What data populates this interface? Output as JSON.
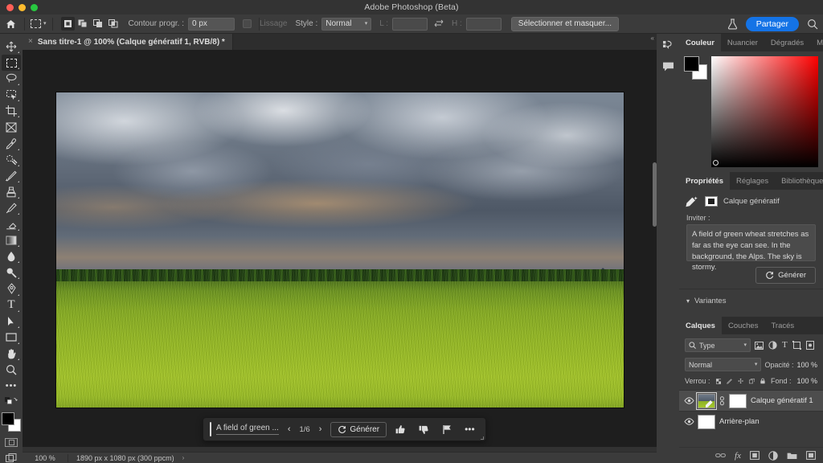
{
  "window": {
    "title": "Adobe Photoshop (Beta)",
    "traffic_lights": [
      "close",
      "minimize",
      "zoom"
    ],
    "accent_color": "#1473e6",
    "chrome_color": "#3b3b3b"
  },
  "options_bar": {
    "home_icon": "home-icon",
    "active_tool": "rectangular-marquee",
    "tool_preset_caret": "⌄",
    "boolean_modes": [
      {
        "name": "new-selection",
        "active": true
      },
      {
        "name": "add-to-selection",
        "active": false
      },
      {
        "name": "subtract-from-selection",
        "active": false
      },
      {
        "name": "intersect-selection",
        "active": false
      }
    ],
    "feather_label": "Contour progr. :",
    "feather_value": "0 px",
    "antialias_label": "Lissage",
    "antialias_checked": false,
    "style_label": "Style :",
    "style_value": "Normal",
    "width_label": "L :",
    "width_value": "",
    "swap_icon": "swap-dimensions-icon",
    "height_label": "H :",
    "height_value": "",
    "select_and_mask_label": "Sélectionner et masquer...",
    "flask_icon": "flask-icon",
    "share_label": "Partager",
    "search_icon": "search-icon"
  },
  "document_tab": {
    "close_icon": "×",
    "title": "Sans titre-1 @ 100% (Calque génératif 1, RVB/8) *",
    "collapse_icon": "«"
  },
  "toolbar": {
    "tools": [
      {
        "name": "move-tool",
        "glyph": "move",
        "selected": false,
        "has_flyout": true
      },
      {
        "name": "rectangular-marquee-tool",
        "glyph": "marquee",
        "selected": true,
        "has_flyout": true
      },
      {
        "name": "lasso-tool",
        "glyph": "lasso",
        "selected": false,
        "has_flyout": true
      },
      {
        "name": "object-selection-tool",
        "glyph": "object-select",
        "selected": false,
        "has_flyout": true
      },
      {
        "name": "crop-tool",
        "glyph": "crop",
        "selected": false,
        "has_flyout": true
      },
      {
        "name": "frame-tool",
        "glyph": "frame",
        "selected": false,
        "has_flyout": false
      },
      {
        "name": "eyedropper-tool",
        "glyph": "eyedropper",
        "selected": false,
        "has_flyout": true
      },
      {
        "name": "spot-healing-brush-tool",
        "glyph": "healing",
        "selected": false,
        "has_flyout": true
      },
      {
        "name": "brush-tool",
        "glyph": "brush",
        "selected": false,
        "has_flyout": true
      },
      {
        "name": "clone-stamp-tool",
        "glyph": "stamp",
        "selected": false,
        "has_flyout": true
      },
      {
        "name": "history-brush-tool",
        "glyph": "history-brush",
        "selected": false,
        "has_flyout": true
      },
      {
        "name": "eraser-tool",
        "glyph": "eraser",
        "selected": false,
        "has_flyout": true
      },
      {
        "name": "gradient-tool",
        "glyph": "gradient",
        "selected": false,
        "has_flyout": true
      },
      {
        "name": "blur-tool",
        "glyph": "blur",
        "selected": false,
        "has_flyout": true
      },
      {
        "name": "dodge-tool",
        "glyph": "dodge",
        "selected": false,
        "has_flyout": true
      },
      {
        "name": "pen-tool",
        "glyph": "pen",
        "selected": false,
        "has_flyout": true
      },
      {
        "name": "type-tool",
        "glyph": "type",
        "selected": false,
        "has_flyout": true
      },
      {
        "name": "path-selection-tool",
        "glyph": "path-select",
        "selected": false,
        "has_flyout": true
      },
      {
        "name": "rectangle-tool",
        "glyph": "rectangle",
        "selected": false,
        "has_flyout": true
      },
      {
        "name": "hand-tool",
        "glyph": "hand",
        "selected": false,
        "has_flyout": true
      },
      {
        "name": "zoom-tool",
        "glyph": "zoom",
        "selected": false,
        "has_flyout": false
      },
      {
        "name": "edit-toolbar",
        "glyph": "ellipsis",
        "selected": false,
        "has_flyout": false
      }
    ],
    "foreground_color": "#000000",
    "background_color": "#ffffff",
    "quick_mask_icon": "quick-mask-icon",
    "screen_mode_icon": "screen-mode-icon"
  },
  "canvas": {
    "image_alt": "A field of green wheat with the Alps under a stormy sky",
    "zoom": "100%"
  },
  "generative_bar": {
    "prompt_text": "A field of green ...",
    "prev_icon": "‹",
    "variation_count": "1/6",
    "next_icon": "›",
    "generate_label": "Générer",
    "generate_icon": "refresh-icon",
    "thumbs_up_icon": "👍",
    "thumbs_down_icon": "👎",
    "flag_icon": "⚑",
    "more_icon": "•••"
  },
  "status_bar": {
    "zoom": "100 %",
    "dimensions": "1890 px x 1080 px (300 ppcm)",
    "expand_icon": "›"
  },
  "rail": {
    "items": [
      {
        "name": "history-panel-icon",
        "glyph": "history"
      },
      {
        "name": "comments-panel-icon",
        "glyph": "comment"
      }
    ]
  },
  "color_panel": {
    "tabs": [
      {
        "label": "Couleur",
        "active": true
      },
      {
        "label": "Nuancier",
        "active": false
      },
      {
        "label": "Dégradés",
        "active": false
      },
      {
        "label": "Motifs",
        "active": false
      }
    ],
    "foreground_color": "#000000",
    "background_color": "#ffffff",
    "field_hue": "#ff0000"
  },
  "properties_panel": {
    "tabs": [
      {
        "label": "Propriétés",
        "active": true
      },
      {
        "label": "Réglages",
        "active": false
      },
      {
        "label": "Bibliothèques",
        "active": false
      }
    ],
    "layer_type_icon": "generative-layer-icon",
    "layer_type_label": "Calque génératif",
    "prompt_label": "Inviter :",
    "prompt_value": "A field of green wheat stretches as far as the eye can see. In the background, the Alps. The sky is stormy.",
    "generate_label": "Générer",
    "generate_icon": "refresh-icon",
    "variants_label": "Variantes",
    "variants_caret": "⌄"
  },
  "layers_panel": {
    "tabs": [
      {
        "label": "Calques",
        "active": true
      },
      {
        "label": "Couches",
        "active": false
      },
      {
        "label": "Tracés",
        "active": false
      }
    ],
    "filter_label": "Type",
    "filter_icons": [
      "pixel-filter-icon",
      "adjustment-filter-icon",
      "type-filter-icon",
      "shape-filter-icon",
      "smart-object-filter-icon"
    ],
    "blend_mode": "Normal",
    "opacity_label": "Opacité :",
    "opacity_value": "100 %",
    "lock_label": "Verrou :",
    "lock_icons": [
      "lock-transparent-pixels-icon",
      "lock-image-pixels-icon",
      "lock-position-icon",
      "lock-artboard-nesting-icon",
      "lock-all-icon"
    ],
    "fill_label": "Fond :",
    "fill_value": "100 %",
    "layers": [
      {
        "name": "Calque génératif 1",
        "visible": true,
        "selected": true,
        "has_mask": true,
        "linked": true,
        "thumb": "image"
      },
      {
        "name": "Arrière-plan",
        "visible": true,
        "selected": false,
        "has_mask": false,
        "linked": false,
        "thumb": "white"
      }
    ],
    "footer_icons": [
      "link-layers-icon",
      "layer-style-fx-icon",
      "add-mask-icon",
      "adjustment-layer-icon",
      "new-group-icon",
      "new-layer-icon"
    ]
  }
}
